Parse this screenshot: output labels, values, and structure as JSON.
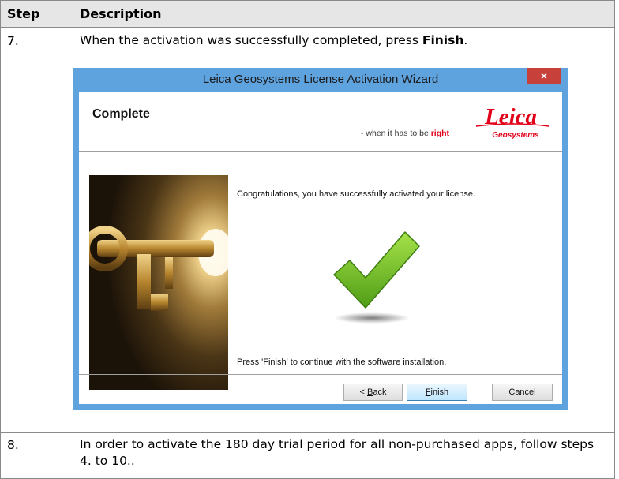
{
  "table": {
    "headers": [
      "Step",
      "Description"
    ],
    "rows": [
      {
        "step": "7.",
        "text_before": "When the activation was successfully completed, press ",
        "text_bold": "Finish",
        "text_after": "."
      },
      {
        "step": "8.",
        "text": "In order to activate the 180 day trial period for all non-purchased apps, follow steps 4. to 10.."
      }
    ]
  },
  "wizard": {
    "title": "Leica Geosystems License Activation Wizard",
    "close_glyph": "×",
    "heading": "Complete",
    "tagline_prefix": "- when it has to be ",
    "tagline_highlight": "right",
    "logo_text": "Leica",
    "logo_sub": "Geosystems",
    "message": "Congratulations, you have successfully activated your license.",
    "footer_message": "Press 'Finish' to continue with the software installation.",
    "buttons": {
      "back_prefix": "< ",
      "back_mnemonic": "B",
      "back_rest": "ack",
      "finish_mnemonic": "F",
      "finish_rest": "inish",
      "cancel": "Cancel"
    },
    "colors": {
      "frame": "#5ea2de",
      "close": "#c7403a",
      "brand_red": "#e2001a",
      "check_green": "#7cc22a"
    }
  }
}
